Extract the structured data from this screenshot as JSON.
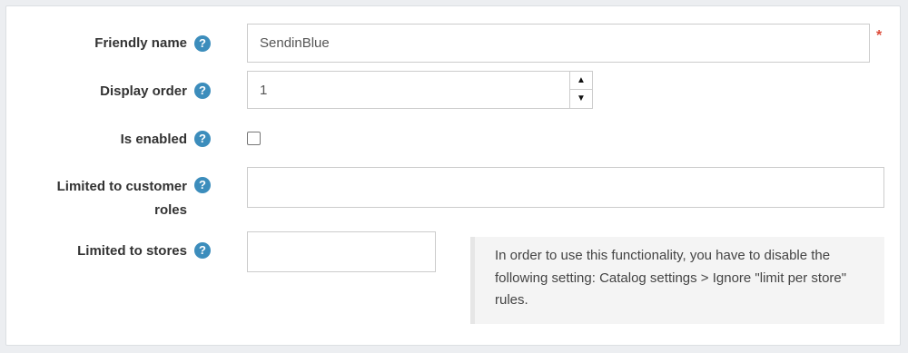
{
  "fields": {
    "friendly_name": {
      "label": "Friendly name",
      "value": "SendinBlue",
      "required_mark": "*"
    },
    "display_order": {
      "label": "Display order",
      "value": "1",
      "up": "▲",
      "down": "▼"
    },
    "is_enabled": {
      "label": "Is enabled",
      "checked": false
    },
    "customer_roles": {
      "label_line1": "Limited to customer",
      "label_line2": "roles",
      "value": ""
    },
    "stores": {
      "label": "Limited to stores",
      "value": ""
    }
  },
  "help_glyph": "?",
  "note_text": "In order to use this functionality, you have to disable the following setting: Catalog settings > Ignore \"limit per store\" rules.",
  "colors": {
    "help_icon": "#3c8dbc",
    "required": "#dd4b39"
  }
}
